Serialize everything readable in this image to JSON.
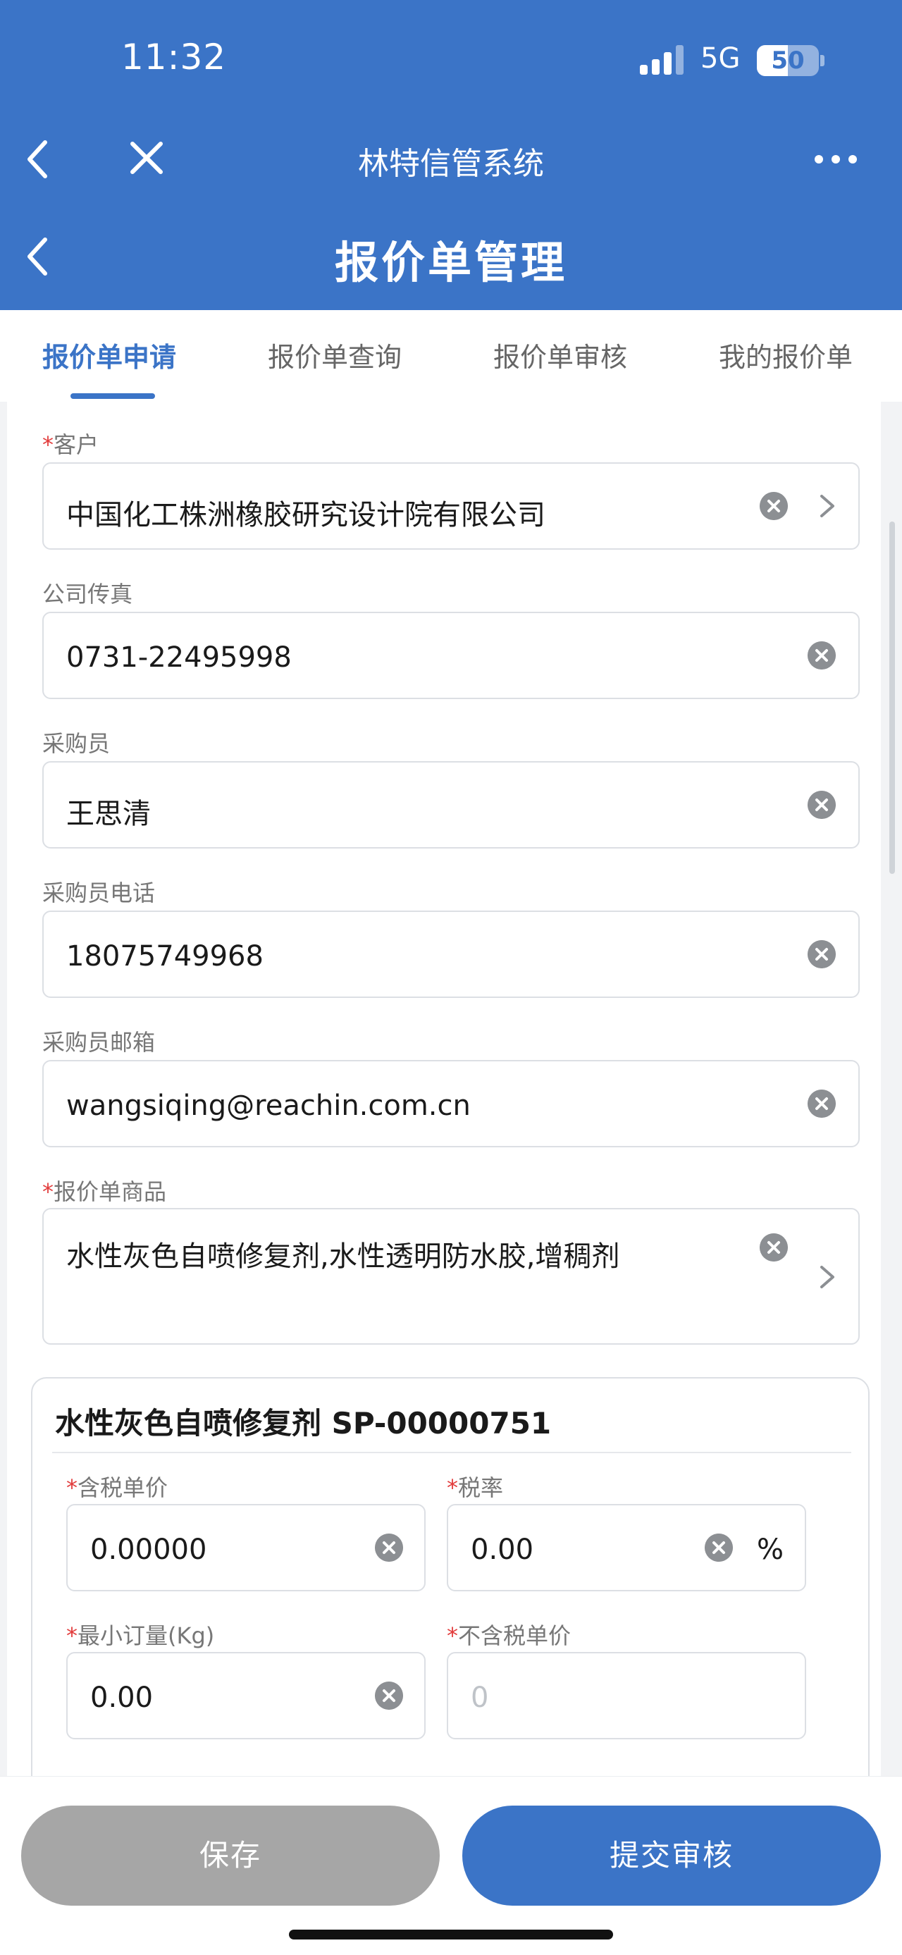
{
  "status_bar": {
    "time": "11:32",
    "network": "5G",
    "battery": "50",
    "battery_fraction": 0.5
  },
  "nav": {
    "app_title": "林特信管系统",
    "page_title": "报价单管理"
  },
  "tabs": [
    "报价单申请",
    "报价单查询",
    "报价单审核",
    "我的报价单"
  ],
  "form": {
    "customer": {
      "label": "客户",
      "value": "中国化工株洲橡胶研究设计院有限公司"
    },
    "fax": {
      "label": "公司传真",
      "value": "0731-22495998"
    },
    "buyer": {
      "label": "采购员",
      "value": "王思清"
    },
    "buyer_phone": {
      "label": "采购员电话",
      "value": "18075749968"
    },
    "buyer_email": {
      "label": "采购员邮箱",
      "value": "wangsiqing@reachin.com.cn"
    },
    "products": {
      "label": "报价单商品",
      "value": "水性灰色自喷修复剂,水性透明防水胶,增稠剂"
    }
  },
  "product_card": {
    "title": "水性灰色自喷修复剂 SP-00000751",
    "price_incl_tax": {
      "label": "含税单价",
      "value": "0.00000"
    },
    "tax_rate": {
      "label": "税率",
      "value": "0.00",
      "unit": "%"
    },
    "min_order": {
      "label": "最小订量(Kg)",
      "value": "0.00"
    },
    "price_excl_tax": {
      "label": "不含税单价",
      "placeholder": "0"
    }
  },
  "actions": {
    "save": "保存",
    "submit": "提交审核"
  },
  "colors": {
    "primary": "#3b74c7",
    "required": "#e23c3c",
    "save_button": "#a6a6a6"
  }
}
